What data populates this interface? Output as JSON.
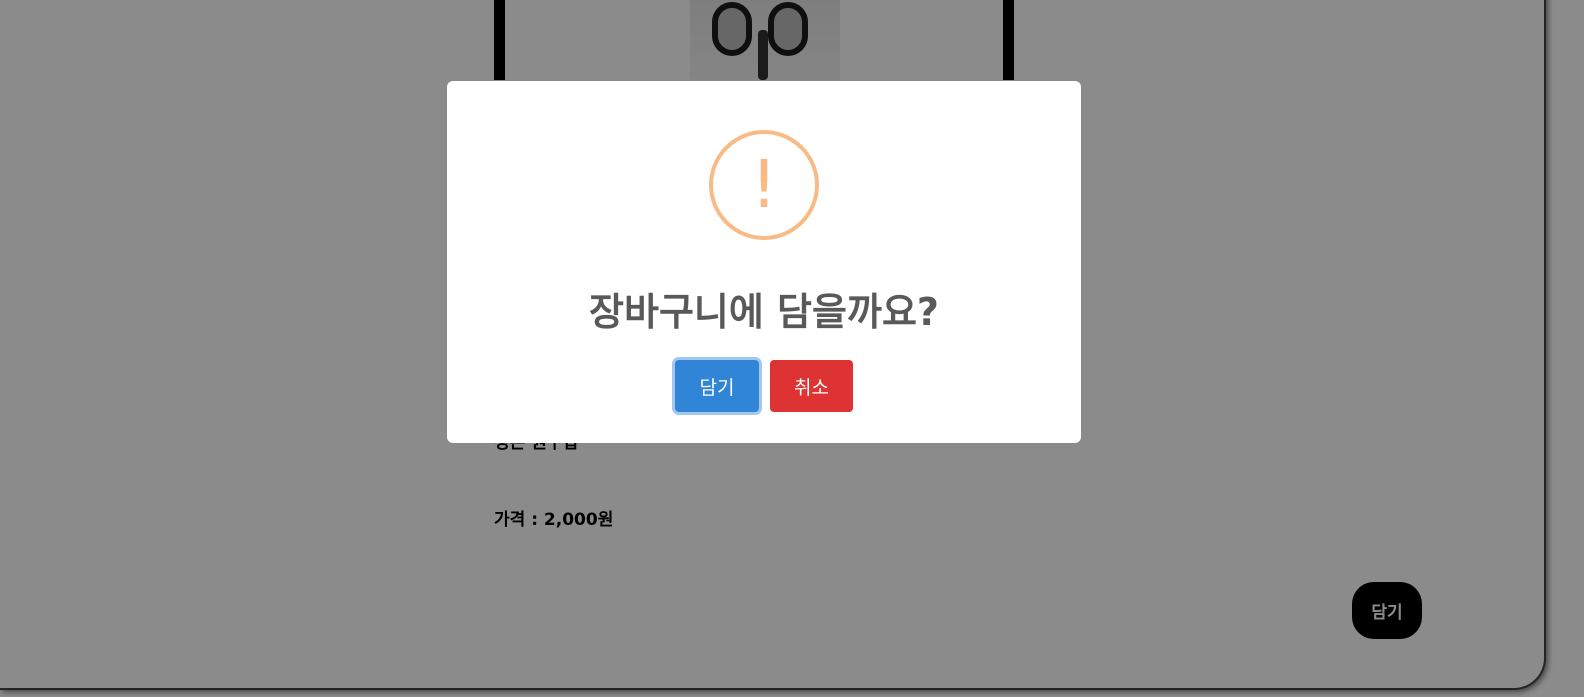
{
  "product": {
    "image_icon": "scissors-image",
    "partial_label": "정은 원구입",
    "price_text": "가격 : 2,000원"
  },
  "floating_button": {
    "label": "담기"
  },
  "dialog": {
    "icon": "warning-icon",
    "icon_glyph": "!",
    "title": "장바구니에 담을까요?",
    "confirm_label": "담기",
    "cancel_label": "취소",
    "colors": {
      "warning": "#f8bb86",
      "confirm": "#3085d6",
      "cancel": "#dd3333",
      "title": "#595959"
    }
  }
}
